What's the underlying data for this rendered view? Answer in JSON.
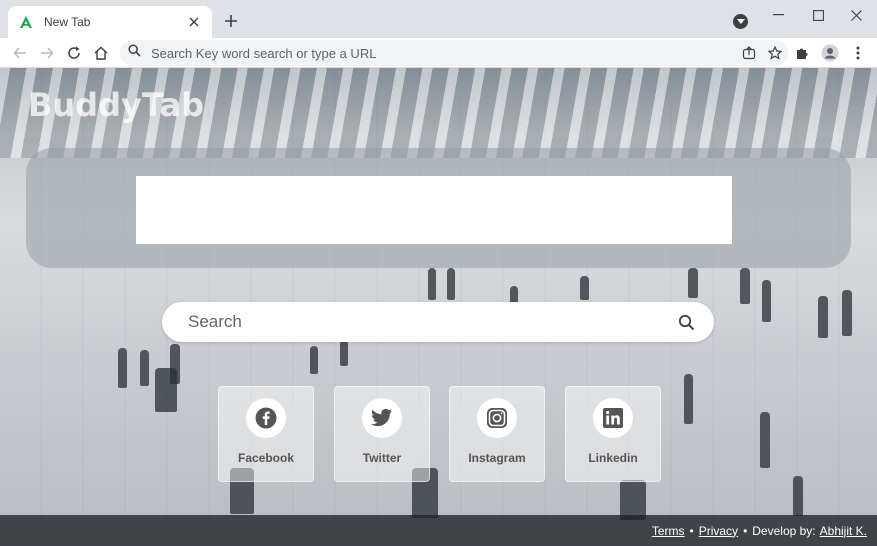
{
  "browser": {
    "tab_title": "New Tab",
    "omnibox_placeholder": "Search Key word search or type a URL"
  },
  "page": {
    "brand": "BuddyTab",
    "search_placeholder": "Search",
    "social": [
      {
        "label": "Facebook",
        "icon": "facebook-icon"
      },
      {
        "label": "Twitter",
        "icon": "twitter-icon"
      },
      {
        "label": "Instagram",
        "icon": "instagram-icon"
      },
      {
        "label": "Linkedin",
        "icon": "linkedin-icon"
      }
    ],
    "footer": {
      "terms": "Terms",
      "privacy": "Privacy",
      "develop_prefix": "Develop by:",
      "developer": "Abhijit K.",
      "separator": "•"
    }
  },
  "colors": {
    "tab_strip": "#dee1e6",
    "favicon_green": "#1ea446",
    "footer_bg": "#1e2024"
  }
}
